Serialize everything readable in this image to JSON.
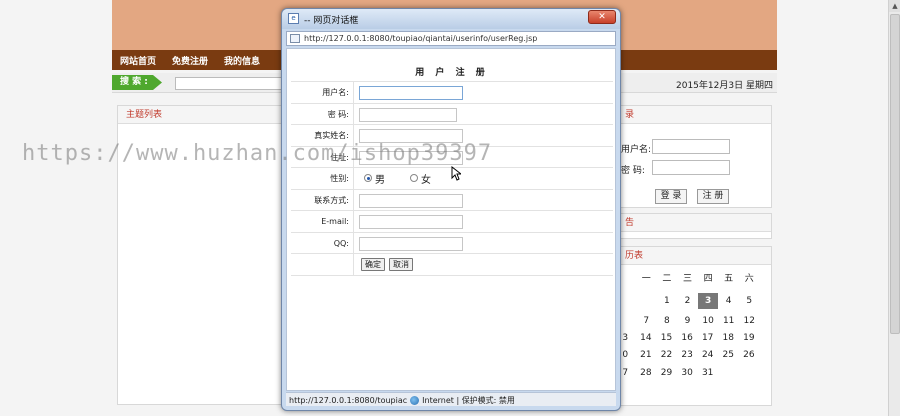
{
  "background": {
    "nav": [
      "网站首页",
      "免费注册",
      "我的信息"
    ],
    "search_label": "搜 索 :",
    "date": "2015年12月3日 星期四",
    "left_panel_title": "主题列表",
    "login_panel": {
      "title": "录",
      "username_label": "用户名:",
      "password_label": "密  码:",
      "login_button": "登 录",
      "register_button": "注 册"
    },
    "notice_panel_title": "告",
    "calendar_title": "历表",
    "calendar_headers": [
      "一",
      "二",
      "三",
      "四",
      "五",
      "六"
    ],
    "calendar_rows": [
      [
        "",
        "1",
        "2",
        "3",
        "4",
        "5"
      ],
      [
        "7",
        "8",
        "9",
        "10",
        "11",
        "12"
      ],
      [
        "3",
        "14",
        "15",
        "16",
        "17",
        "18",
        "19"
      ],
      [
        "0",
        "21",
        "22",
        "23",
        "24",
        "25",
        "26"
      ],
      [
        "7",
        "28",
        "29",
        "30",
        "31",
        "",
        ""
      ]
    ],
    "calendar_today": "3"
  },
  "watermark": "https://www.huzhan.com/ishop39397",
  "dialog": {
    "title": "-- 网页对话框",
    "close_glyph": "✕",
    "address": "http://127.0.0.1:8080/toupiao/qiantai/userinfo/userReg.jsp",
    "form_title": "用 户 注 册",
    "fields": {
      "username": "用户名:",
      "password": "密  码:",
      "realname": "真实姓名:",
      "address": "住址:",
      "gender": "性别:",
      "contact": "联系方式:",
      "email": "E-mail:",
      "qq": "QQ:"
    },
    "gender_male": "男",
    "gender_female": "女",
    "confirm_button": "确定",
    "cancel_button": "取消",
    "status": {
      "url": "http://127.0.0.1:8080/toupiac",
      "zone": "Internet | 保护模式: 禁用"
    }
  }
}
